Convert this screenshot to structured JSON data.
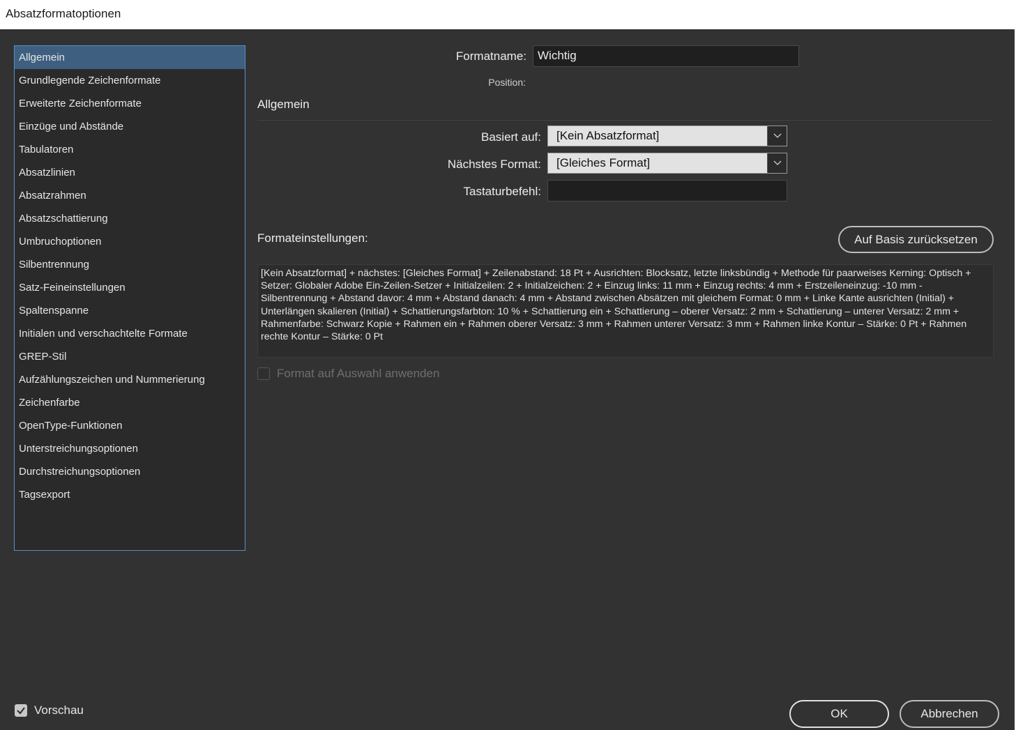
{
  "window": {
    "title": "Absatzformatoptionen"
  },
  "sidebar": {
    "items": [
      {
        "label": "Allgemein",
        "active": true
      },
      {
        "label": "Grundlegende Zeichenformate"
      },
      {
        "label": "Erweiterte Zeichenformate"
      },
      {
        "label": "Einzüge und Abstände"
      },
      {
        "label": "Tabulatoren"
      },
      {
        "label": "Absatzlinien"
      },
      {
        "label": "Absatzrahmen"
      },
      {
        "label": "Absatzschattierung"
      },
      {
        "label": "Umbruchoptionen"
      },
      {
        "label": "Silbentrennung"
      },
      {
        "label": "Satz-Feineinstellungen"
      },
      {
        "label": "Spaltenspanne"
      },
      {
        "label": "Initialen und verschachtelte Formate"
      },
      {
        "label": "GREP-Stil"
      },
      {
        "label": "Aufzählungszeichen und Nummerierung"
      },
      {
        "label": "Zeichenfarbe"
      },
      {
        "label": "OpenType-Funktionen"
      },
      {
        "label": "Unterstreichungsoptionen"
      },
      {
        "label": "Durchstreichungsoptionen"
      },
      {
        "label": "Tagsexport"
      }
    ]
  },
  "main": {
    "format_name_label": "Formatname:",
    "format_name_value": "Wichtig",
    "position_label": "Position:",
    "section_title": "Allgemein",
    "based_on_label": "Basiert auf:",
    "based_on_value": "[Kein Absatzformat]",
    "next_style_label": "Nächstes Format:",
    "next_style_value": "[Gleiches Format]",
    "shortcut_label": "Tastaturbefehl:",
    "shortcut_value": "",
    "settings_label": "Formateinstellungen:",
    "reset_button": "Auf Basis zurücksetzen",
    "settings_summary": "[Kein Absatzformat] + nächstes: [Gleiches Format] + Zeilenabstand: 18 Pt + Ausrichten: Blocksatz, letzte linksbündig + Methode für paarweises Kerning: Optisch + Setzer:  Globaler Adobe Ein-Zeilen-Setzer + Initialzeilen:  2 + Initialzeichen:  2 + Einzug links: 11 mm + Einzug rechts: 4 mm + Erstzeileneinzug: -10 mm - Silbentrennung + Abstand davor: 4 mm + Abstand danach: 4 mm + Abstand zwischen Absätzen mit gleichem Format: 0 mm + Linke Kante ausrichten (Initial) + Unterlängen skalieren (Initial) + Schattierungsfarbton: 10 % + Schattierung ein + Schattierung – oberer Versatz: 2 mm + Schattierung – unterer Versatz: 2 mm + Rahmenfarbe: Schwarz Kopie + Rahmen ein + Rahmen oberer Versatz: 3 mm + Rahmen unterer Versatz: 3 mm + Rahmen linke Kontur – Stärke: 0 Pt + Rahmen rechte Kontur – Stärke: 0 Pt",
    "apply_checkbox_label": "Format auf Auswahl anwenden",
    "apply_checked": false
  },
  "footer": {
    "preview_label": "Vorschau",
    "preview_checked": true,
    "ok_button": "OK",
    "cancel_button": "Abbrechen"
  },
  "colors": {
    "background": "#323232",
    "sidebar_selection": "#3e5f80",
    "sidebar_border": "#5b8fc9"
  }
}
